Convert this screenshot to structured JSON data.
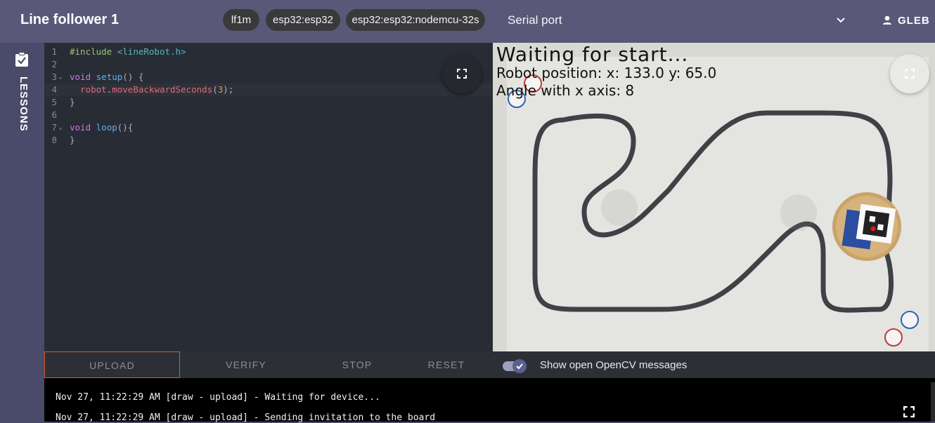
{
  "header": {
    "title": "Line follower 1",
    "chips": [
      "lf1m",
      "esp32:esp32",
      "esp32:esp32:nodemcu-32s"
    ],
    "serial_port_label": "Serial port",
    "user_name": "GLEB"
  },
  "sidebar": {
    "lessons_label": "LESSONS"
  },
  "editor": {
    "line_numbers": [
      "1",
      "2",
      "3",
      "4",
      "5",
      "6",
      "7",
      "8"
    ],
    "code": {
      "l1_directive": "#include",
      "l1_header": "<lineRobot.h>",
      "l3_type": "void",
      "l3_func": "setup",
      "l3_rest": "() {",
      "l4_obj": "robot",
      "l4_dot": ".",
      "l4_method": "moveBackwardSeconds",
      "l4_open": "(",
      "l4_arg": "3",
      "l4_close": ");",
      "l5": "}",
      "l7_type": "void",
      "l7_func": "loop",
      "l7_rest": "(){",
      "l8": "}"
    }
  },
  "camera": {
    "status": "Waiting for start...",
    "position": "Robot position: x: 133.0 y: 65.0",
    "angle": "Angle with x axis: 8"
  },
  "controls": {
    "upload": "UPLOAD",
    "verify": "VERIFY",
    "stop": "STOP",
    "reset": "RESET",
    "opencv_label": "Show open OpenCV messages",
    "opencv_enabled": true
  },
  "console": {
    "lines": [
      "Nov 27, 11:22:29 AM [draw - upload] - Waiting for device...",
      "Nov 27, 11:22:29 AM [draw - upload] - Sending invitation to the board"
    ]
  },
  "colors": {
    "accent_upload_border": "#d9552f",
    "header_bg": "#595878",
    "editor_bg": "#282c34"
  }
}
